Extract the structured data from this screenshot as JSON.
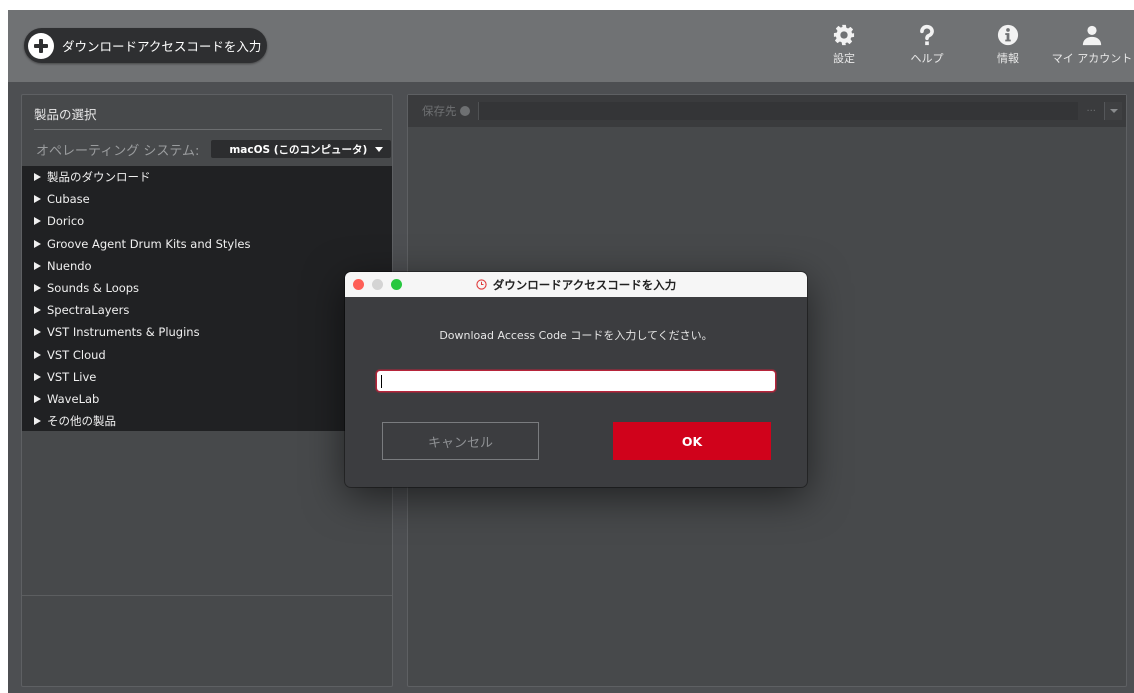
{
  "topbar": {
    "access_button_label": "ダウンロードアクセスコードを入力",
    "tools": [
      {
        "label": "設定",
        "icon": "gear-icon"
      },
      {
        "label": "ヘルプ",
        "icon": "question-icon"
      },
      {
        "label": "情報",
        "icon": "info-icon"
      },
      {
        "label": "マイ アカウント",
        "icon": "user-icon"
      }
    ]
  },
  "left_panel": {
    "header": "製品の選択",
    "os_label": "オペレーティング システム:",
    "os_value": "macOS (このコンピュータ)",
    "items": [
      {
        "label": "製品のダウンロード"
      },
      {
        "label": "Cubase"
      },
      {
        "label": "Dorico"
      },
      {
        "label": "Groove Agent Drum Kits and Styles"
      },
      {
        "label": "Nuendo"
      },
      {
        "label": "Sounds & Loops"
      },
      {
        "label": "SpectraLayers"
      },
      {
        "label": "VST Instruments & Plugins"
      },
      {
        "label": "VST Cloud"
      },
      {
        "label": "VST Live"
      },
      {
        "label": "WaveLab"
      },
      {
        "label": "その他の製品"
      }
    ]
  },
  "right_panel": {
    "save_label": "保存先",
    "browse_label": "..."
  },
  "dialog": {
    "title": "ダウンロードアクセスコードを入力",
    "prompt": "Download Access Code コードを入力してください。",
    "input_value": "",
    "cancel_label": "キャンセル",
    "ok_label": "OK"
  },
  "colors": {
    "accent": "#d0021b",
    "background": "#4d4f52",
    "topbar": "#707274"
  }
}
